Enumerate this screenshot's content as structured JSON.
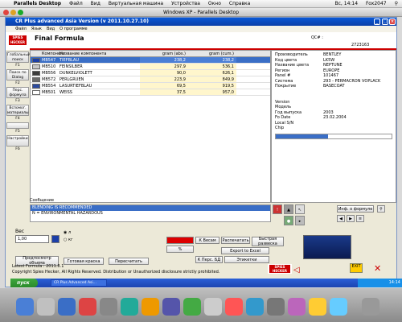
{
  "mac_menubar": {
    "app": "Parallels Desktop",
    "items": [
      "Файл",
      "Вид",
      "Виртуальная машина",
      "Устройства",
      "Окно",
      "Справка"
    ],
    "clock": "Вс, 14:14",
    "user": "Fox2047"
  },
  "parallels_title": "Windows XP - Parallels Desktop",
  "window": {
    "title": "CR Plus advanced Asia Version (v 2011.10.27.10)",
    "menu": [
      "Файл",
      "Язык",
      "Вид",
      "О программе"
    ]
  },
  "brand": {
    "logo_text": "SPIES HECKER"
  },
  "header": {
    "title": "Final Formula",
    "qc_label": "QC# :",
    "qc_value": "2723163"
  },
  "sidebar": [
    {
      "label": "Глобальный поиск",
      "key": "F1"
    },
    {
      "label": "Поиск по Dialog",
      "key": "F2"
    },
    {
      "label": "Перс. формула",
      "key": "F3"
    },
    {
      "label": "Вспомог. материалы",
      "key": "F4"
    },
    {
      "label": "",
      "key": "F5"
    },
    {
      "label": "Настройки",
      "key": "F6"
    }
  ],
  "table": {
    "headers": [
      "",
      "Компонент",
      "Название компонента",
      "gram (abs.)",
      "gram (cum.)"
    ],
    "rows": [
      {
        "swatch": "#1c3fa8",
        "code": "MB547",
        "name": "TIEFBLAU",
        "abs": "238,2",
        "cum": "238,2",
        "selected": true
      },
      {
        "swatch": "#c8c8c8",
        "code": "MB510",
        "name": "FEINSILBER",
        "abs": "297,9",
        "cum": "536,1",
        "selected": false
      },
      {
        "swatch": "#3c3c3c",
        "code": "MB556",
        "name": "DUNKELVIOLETT",
        "abs": "90,0",
        "cum": "626,1",
        "selected": false
      },
      {
        "swatch": "#6a6a6a",
        "code": "MB572",
        "name": "PERLGRUEN",
        "abs": "223,9",
        "cum": "849,9",
        "selected": false
      },
      {
        "swatch": "#2a4aa0",
        "code": "MB554",
        "name": "LASURTIEFBLAU",
        "abs": "69,5",
        "cum": "919,5",
        "selected": false
      },
      {
        "swatch": "#ffffff",
        "code": "MB501",
        "name": "WEISS",
        "abs": "37,5",
        "cum": "957,0",
        "selected": false
      }
    ]
  },
  "info": {
    "rows": [
      {
        "k": "Производитель",
        "v": "BENTLEY"
      },
      {
        "k": "Код цвета",
        "v": "LK5W"
      },
      {
        "k": "Название цвета",
        "v": "NEPTUNE"
      },
      {
        "k": "Регион",
        "v": "EUROPE"
      },
      {
        "k": "Panel #",
        "v": "101467"
      },
      {
        "k": "Система",
        "v": "293 - PERMACRON VOPLACK"
      },
      {
        "k": "Покрытие",
        "v": "BASECOAT"
      },
      {
        "k": "",
        "v": ""
      },
      {
        "k": "",
        "v": ""
      },
      {
        "k": "Version",
        "v": ""
      },
      {
        "k": "Модель",
        "v": ""
      },
      {
        "k": "Год выпуска",
        "v": "2003"
      },
      {
        "k": "Fo Date",
        "v": "23.02.2004"
      },
      {
        "k": "Local S/N",
        "v": ""
      },
      {
        "k": "Chip",
        "v": ""
      }
    ]
  },
  "messages": {
    "label": "Сообщение",
    "lines": [
      "BLENDING IS RECOMMENDED",
      "N = ENVIRONMENTAL HAZARDOUS"
    ]
  },
  "controls": {
    "formula_info": "Инф. о формуле",
    "weight_label": "Вес",
    "weight_value": "1,00",
    "unit_l": "л",
    "unit_kg": "кг",
    "prev_button": "Предпосмотр объема",
    "ready_paint": "Готовая краска",
    "recalc": "Пересчитать",
    "to_weights": "К Весам",
    "print": "Распечатать",
    "quick_weigh": "Быстрая развеска",
    "export_excel": "Export to Excel",
    "to_db": "К Перс. БД",
    "labels": "Этикетки",
    "percent": "%"
  },
  "footer": {
    "line1": "Latest Formula : 2011.8.1",
    "line2": "Copyright Spies Hecker, All Rights Reserved. Distribution or Unauthorized disclosure strictly prohibited."
  },
  "exit_label": "EXIT",
  "taskbar": {
    "start": "пуск",
    "task": "CR Plus Advanced Asi...",
    "clock": "14:14"
  }
}
